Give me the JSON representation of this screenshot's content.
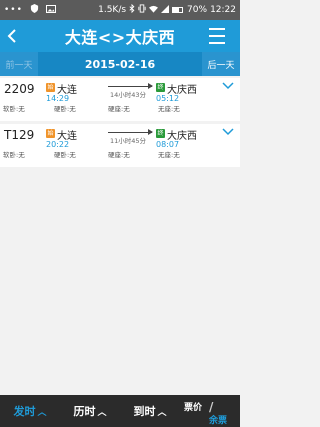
{
  "status_bar": {
    "network_speed": "1.5K/s",
    "battery": "70%",
    "time": "12:22"
  },
  "header": {
    "title": "大连<>大庆西"
  },
  "date_bar": {
    "prev_label": "前一天",
    "date": "2015-02-16",
    "next_label": "后一天"
  },
  "trains": [
    {
      "number": "2209",
      "start_tag": "始",
      "from": "大连",
      "depart_time": "14:29",
      "duration": "14小时43分",
      "end_tag": "终",
      "to": "大庆西",
      "arrive_time": "05:12",
      "soft_sleeper": "软卧:无",
      "hard_sleeper": "硬卧:无",
      "hard_seat": "硬座:无",
      "no_seat": "无座:无"
    },
    {
      "number": "T129",
      "start_tag": "始",
      "from": "大连",
      "depart_time": "20:22",
      "duration": "11小时45分",
      "end_tag": "终",
      "to": "大庆西",
      "arrive_time": "08:07",
      "soft_sleeper": "软卧:无",
      "hard_sleeper": "硬卧:无",
      "hard_seat": "硬座:无",
      "no_seat": "无座:无"
    }
  ],
  "bottom_bar": {
    "depart_label": "发时",
    "duration_label": "历时",
    "arrive_label": "到时",
    "price_label": "票价",
    "remain_label": "余票"
  },
  "colors": {
    "primary": "#1f9bd8",
    "datebar": "#1787c4",
    "start_tag": "#f0942b",
    "end_tag": "#2a9a3a",
    "bottom_bar": "#2b2b2b"
  },
  "icons": {
    "back": "chevron-left-icon",
    "menu": "menu-icon",
    "expand": "chevron-down-icon"
  }
}
